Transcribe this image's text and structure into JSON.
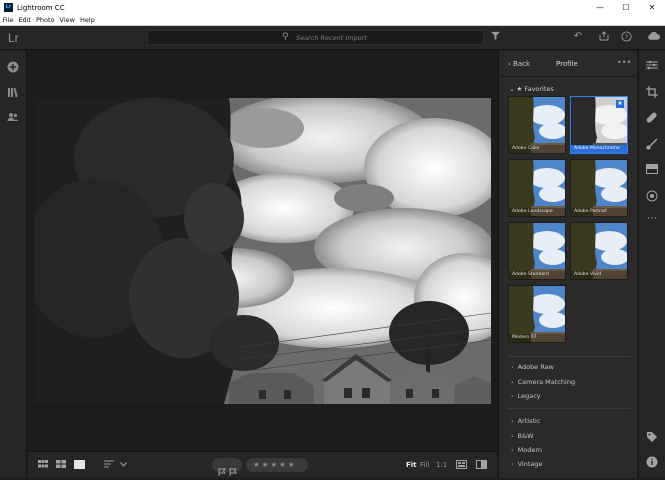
{
  "window": {
    "title": "Lightroom CC",
    "app_icon_text": "Lr",
    "controls": [
      "—",
      "☐",
      "✕"
    ]
  },
  "menu": [
    "File",
    "Edit",
    "Photo",
    "View",
    "Help"
  ],
  "topbar": {
    "logo": "Lr",
    "search_placeholder": "Search Recent Import"
  },
  "panel": {
    "back_label": "Back",
    "title": "Profile",
    "more": "•••",
    "favorites_label": "Favorites",
    "favorites": [
      {
        "name": "Adobe Color",
        "selected": false
      },
      {
        "name": "Adobe Monochrome",
        "selected": true
      },
      {
        "name": "Adobe Landscape",
        "selected": false
      },
      {
        "name": "Adobe Portrait",
        "selected": false
      },
      {
        "name": "Adobe Standard",
        "selected": false
      },
      {
        "name": "Adobe Vivid",
        "selected": false
      },
      {
        "name": "Modern 07",
        "selected": false
      }
    ],
    "groups_a": [
      "Adobe Raw",
      "Camera Matching",
      "Legacy"
    ],
    "groups_b": [
      "Artistic",
      "B&W",
      "Modern",
      "Vintage"
    ]
  },
  "bottombar": {
    "zoom_fit": "Fit",
    "zoom_fill": "Fill",
    "zoom_1to1": "1:1",
    "rating": "★★★★★"
  },
  "colors": {
    "accent": "#2b6fd6",
    "bg": "#1d1d1d",
    "panel": "#2a2a2a"
  }
}
